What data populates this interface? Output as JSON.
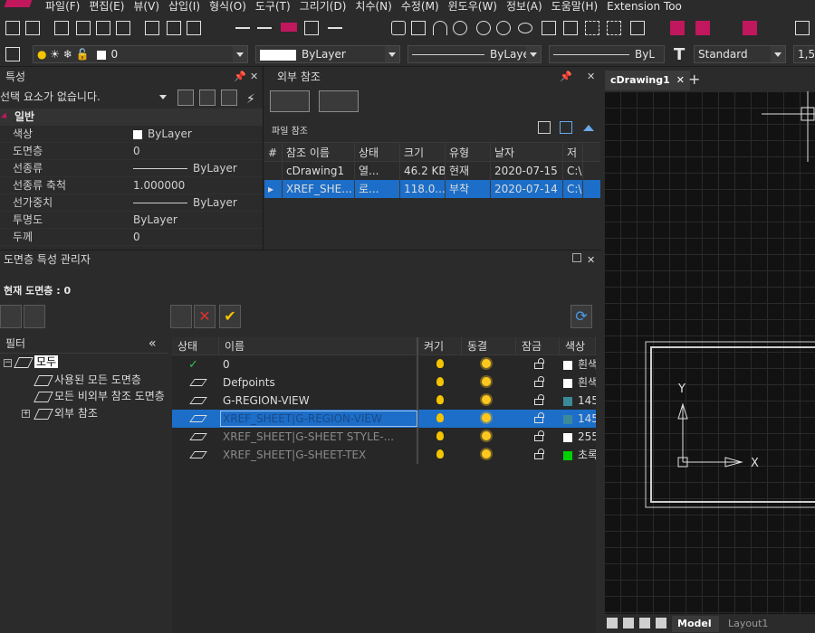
{
  "menu": [
    "파일(F)",
    "편집(E)",
    "뷰(V)",
    "삽입(I)",
    "형식(O)",
    "도구(T)",
    "그리기(D)",
    "치수(N)",
    "수정(M)",
    "윈도우(W)",
    "정보(A)",
    "도움말(H)",
    "Extension Too"
  ],
  "toolbar2": {
    "layer_value": "0",
    "color_value": "ByLayer",
    "linetype_value": "ByLayer",
    "lineweight_value": "ByL",
    "textstyle_value": "Standard",
    "scale_value": "1,5"
  },
  "properties": {
    "title": "특성",
    "selection": "선택 요소가 없습니다.",
    "group": "일반",
    "rows": [
      {
        "key": "색상",
        "value": "ByLayer"
      },
      {
        "key": "도면층",
        "value": "0"
      },
      {
        "key": "선종류",
        "value": "ByLayer"
      },
      {
        "key": "선종류 축척",
        "value": "1.000000"
      },
      {
        "key": "선가중치",
        "value": "ByLayer"
      },
      {
        "key": "투명도",
        "value": "ByLayer"
      },
      {
        "key": "두께",
        "value": "0"
      }
    ]
  },
  "xref": {
    "title": "외부 참조",
    "caption": "파일 참조",
    "columns": [
      "#",
      "참조 이름",
      "상태",
      "크기",
      "유형",
      "날자",
      "저"
    ],
    "rows": [
      {
        "name": "cDrawing1",
        "status": "열...",
        "size": "46.2 KB",
        "type": "현재",
        "date": "2020-07-15",
        "path": "C:\\"
      },
      {
        "name": "XREF_SHE...",
        "status": "로...",
        "size": "118.0...",
        "type": "부착",
        "date": "2020-07-14",
        "path": "C:\\"
      }
    ]
  },
  "drawing": {
    "tab": "cDrawing1",
    "axis_x": "X",
    "axis_y": "Y",
    "layout_tabs": [
      "Model",
      "Layout1"
    ]
  },
  "layers": {
    "title": "도면층 특성 관리자",
    "current": "현재 도면층 : 0",
    "filter_title": "필터",
    "tree": {
      "all": "모두",
      "used": "사용된 모든 도면층",
      "non_xref": "모든 비외부 참조 도면층",
      "xref": "외부 참조"
    },
    "columns": [
      "상태",
      "이름",
      "켜기",
      "동결",
      "잠금",
      "색상"
    ],
    "rows": [
      {
        "name": "0",
        "color": "흰색",
        "swatch": "#ffffff"
      },
      {
        "name": "Defpoints",
        "color": "흰색",
        "swatch": "#ffffff"
      },
      {
        "name": "G-REGION-VIEW",
        "color": "145",
        "swatch": "#3a8a9a"
      },
      {
        "name": "XREF_SHEET|G-REGION-VIEW",
        "color": "145",
        "swatch": "#3a8a9a"
      },
      {
        "name": "XREF_SHEET|G-SHEET STYLE-...",
        "color": "255",
        "swatch": "#ffffff"
      },
      {
        "name": "XREF_SHEET|G-SHEET-TEX",
        "color": "초록",
        "swatch": "#00d000"
      }
    ]
  }
}
